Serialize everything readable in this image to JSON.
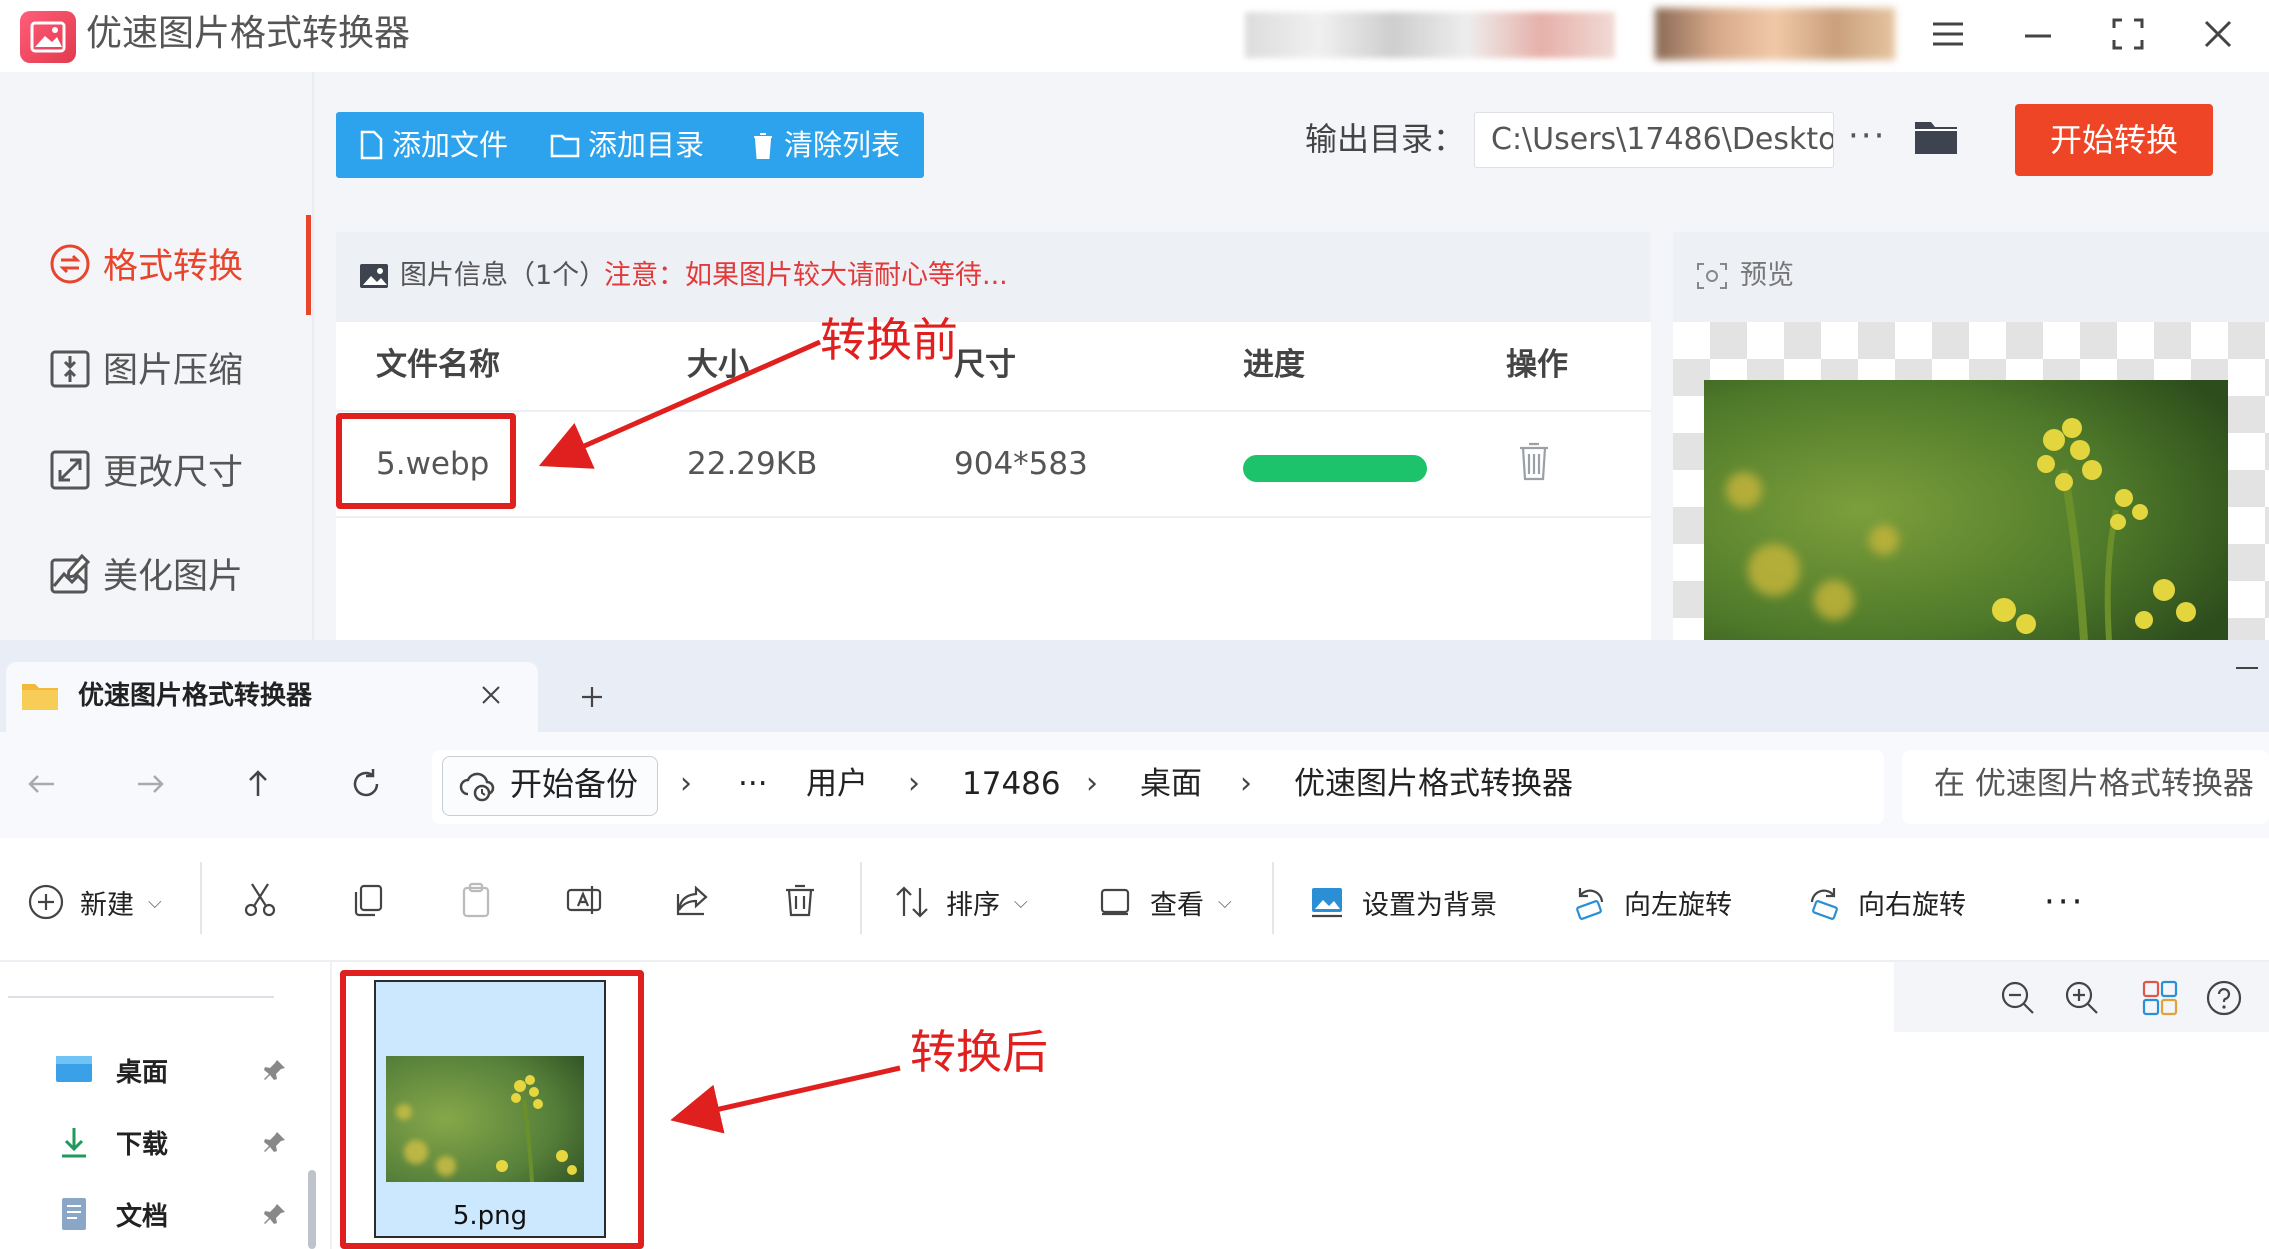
{
  "app": {
    "title": "优速图片格式转换器",
    "toolbar": {
      "add_file": "添加文件",
      "add_folder": "添加目录",
      "clear_list": "清除列表"
    },
    "output_label": "输出目录：",
    "output_path": "C:\\Users\\17486\\Deskto",
    "more_label": "···",
    "start_button": "开始转换",
    "sidebar": {
      "items": [
        {
          "label": "格式转换",
          "icon": "format-convert-icon",
          "active": true
        },
        {
          "label": "图片压缩",
          "icon": "compress-icon",
          "active": false
        },
        {
          "label": "更改尺寸",
          "icon": "resize-icon",
          "active": false
        },
        {
          "label": "美化图片",
          "icon": "beautify-icon",
          "active": false
        }
      ]
    },
    "info": {
      "title": "图片信息（1个）",
      "note": "注意：如果图片较大请耐心等待..."
    },
    "table": {
      "columns": [
        "文件名称",
        "大小",
        "尺寸",
        "进度",
        "操作"
      ],
      "rows": [
        {
          "name": "5.webp",
          "size": "22.29KB",
          "dimensions": "904*583",
          "progress": 1.0
        }
      ]
    },
    "preview_label": "预览",
    "accent_color": "#ee4526",
    "toolbar_color": "#2ea3ed",
    "progress_color": "#1dc36a"
  },
  "explorer": {
    "tab_title": "优速图片格式转换器",
    "address": {
      "backup_label": "开始备份",
      "ellipsis": "···",
      "crumbs": [
        "用户",
        "17486",
        "桌面",
        "优速图片格式转换器"
      ]
    },
    "search_placeholder": "在 优速图片格式转换器",
    "commands": {
      "new": "新建",
      "sort": "排序",
      "view": "查看",
      "set_background": "设置为背景",
      "rotate_left": "向左旋转",
      "rotate_right": "向右旋转",
      "more": "···"
    },
    "nav_items": [
      {
        "label": "桌面",
        "icon": "desktop-icon"
      },
      {
        "label": "下载",
        "icon": "download-icon"
      },
      {
        "label": "文档",
        "icon": "documents-icon"
      }
    ],
    "file": {
      "name": "5.png"
    }
  },
  "annotations": {
    "before": "转换前",
    "after": "转换后",
    "color": "#e01f1f"
  }
}
